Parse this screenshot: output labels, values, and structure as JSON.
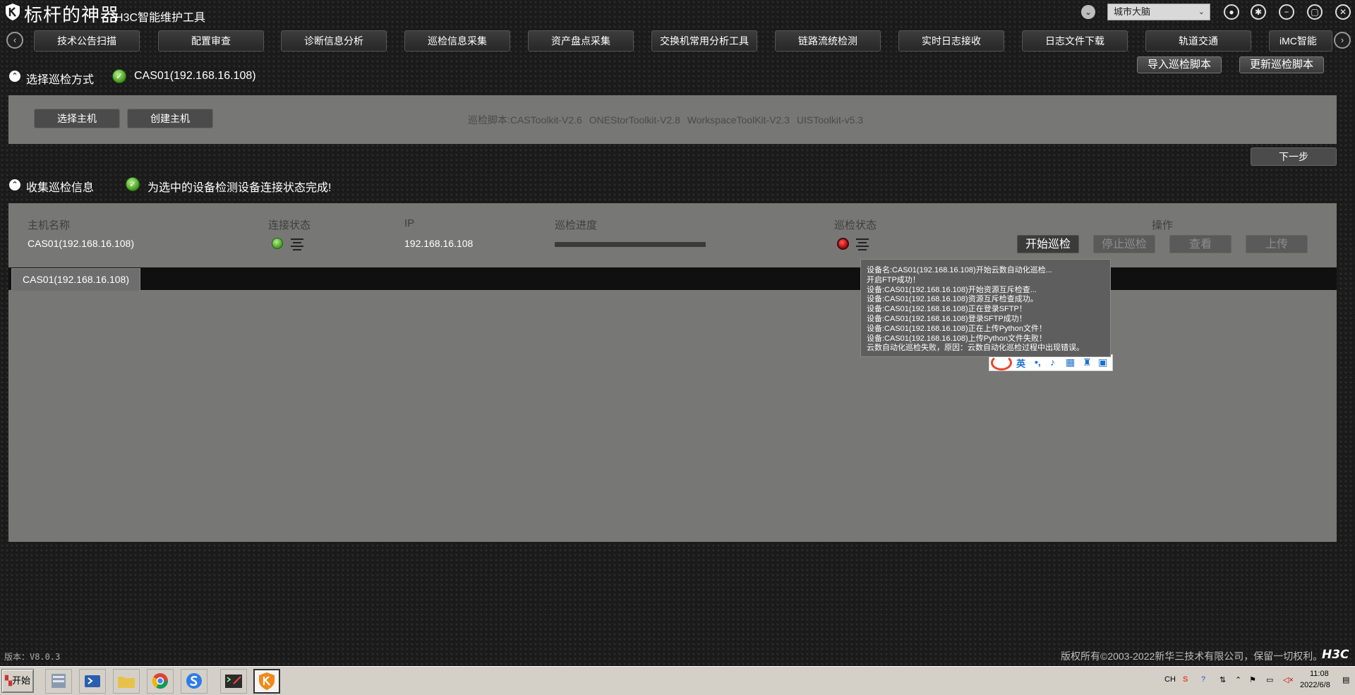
{
  "app": {
    "title": "标杆的神器",
    "subtitle": "H3C智能维护工具",
    "city": "城市大脑"
  },
  "nav": {
    "tabs": [
      "技术公告扫描",
      "配置审查",
      "诊断信息分析",
      "巡检信息采集",
      "资产盘点采集",
      "交换机常用分析工具",
      "链路流统检测",
      "实时日志接收",
      "日志文件下载",
      "轨道交通",
      "iMC智能"
    ]
  },
  "buttons": {
    "import_script": "导入巡检脚本",
    "update_script": "更新巡检脚本",
    "select_host": "选择主机",
    "create_host": "创建主机",
    "next_step": "下一步"
  },
  "section1": {
    "title": "选择巡检方式",
    "host": "CAS01(192.168.16.108)",
    "scripts": "巡检脚本:CASToolkit-V2.6 ONEStorToolkit-V2.8 WorkspaceToolKit-V2.3 UISToolkit-v5.3"
  },
  "section2": {
    "title": "收集巡检信息",
    "status": "为选中的设备检测设备连接状态完成!"
  },
  "table": {
    "headers": {
      "host": "主机名称",
      "conn": "连接状态",
      "ip": "IP",
      "progress": "巡检进度",
      "status": "巡检状态",
      "actions": "操作"
    },
    "row": {
      "host": "CAS01(192.168.16.108)",
      "ip": "192.168.16.108",
      "progress": 0
    },
    "actions": {
      "start": "开始巡检",
      "stop": "停止巡检",
      "view": "查看",
      "upload": "上传"
    }
  },
  "device_tab": "CAS01(192.168.16.108)",
  "tooltip": [
    "设备名:CAS01(192.168.16.108)开始云数自动化巡检...",
    "开启FTP成功！",
    "设备:CAS01(192.168.16.108)开始资源互斥检查...",
    "设备:CAS01(192.168.16.108)资源互斥检查成功。",
    "设备:CAS01(192.168.16.108)正在登录SFTP！",
    "设备:CAS01(192.168.16.108)登录SFTP成功！",
    "设备:CAS01(192.168.16.108)正在上传Python文件！",
    "设备:CAS01(192.168.16.108)上传Python文件失败！",
    "云数自动化巡检失败，原因：云数自动化巡检过程中出现错误。"
  ],
  "ime": {
    "lang": "英"
  },
  "footer": {
    "version": "版本：V8.0.3",
    "copyright": "版权所有©2003-2022新华三技术有限公司，保留一切权利。",
    "brand": "H3C"
  },
  "taskbar": {
    "start": "开始",
    "lang": "CH",
    "time": "11:08",
    "date": "2022/6/8"
  }
}
